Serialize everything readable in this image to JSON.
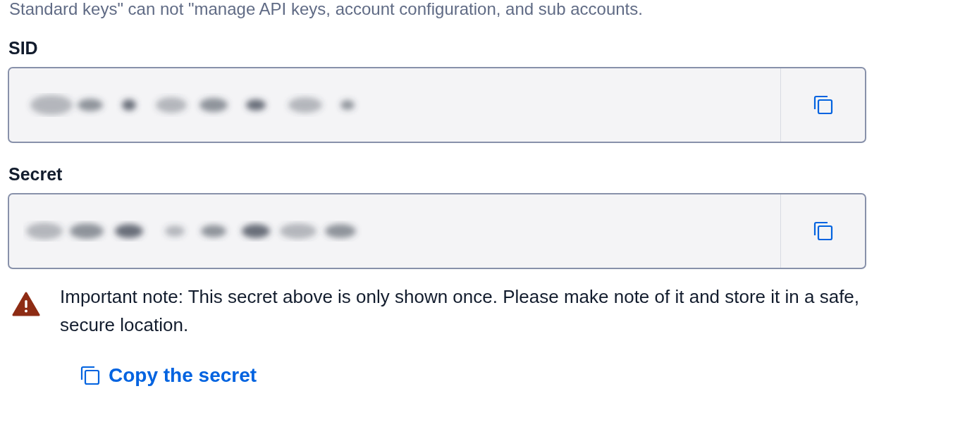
{
  "intro": "Standard keys\" can not \"manage API keys, account configuration, and sub accounts.",
  "fields": [
    {
      "label": "SID"
    },
    {
      "label": "Secret"
    }
  ],
  "note": "Important note: This secret above is only shown once. Please make note of it and store it in a safe, secure location.",
  "copy_link": "Copy the secret"
}
